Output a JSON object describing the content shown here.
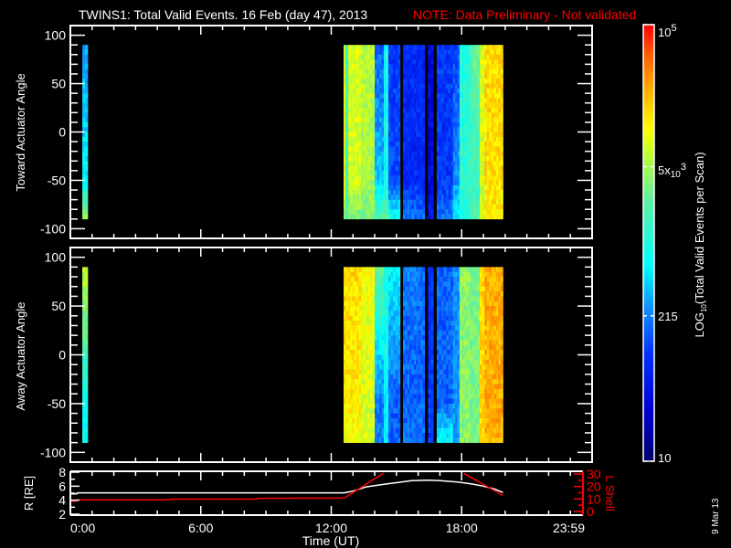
{
  "title": {
    "main": "TWINS1: Total Valid Events. 16 Feb (day  47), 2013",
    "note": "NOTE: Data Preliminary - Not validated"
  },
  "colors": {
    "ephem_R": "#ffffff",
    "ephem_L": "#ff0000",
    "axis": "#ffffff",
    "note": "#ff0000"
  },
  "date_stamp": "9 Mar 13",
  "chart_data": [
    {
      "type": "heatmap",
      "name": "toward",
      "ylabel": "Toward Actuator Angle",
      "ylim": [
        -110,
        110
      ],
      "yticks": [
        100,
        50,
        0,
        -50,
        -100
      ],
      "yticklabels": [
        "100",
        "50",
        "0",
        "-50",
        "-100"
      ],
      "xlim_hours": [
        0,
        24
      ],
      "value_units": "log10 events per scan",
      "columns_note": "each column: [t_start_h, t_end_h, value_at_+90, value_at_-50, value_at_-90]",
      "columns": [
        [
          0.55,
          0.8,
          2.5,
          2.8,
          3.6
        ],
        [
          12.57,
          12.65,
          4.0,
          4.0,
          3.6
        ],
        [
          12.65,
          12.78,
          3.2,
          3.2,
          3.4
        ],
        [
          12.78,
          13.37,
          3.9,
          3.9,
          3.5
        ],
        [
          13.37,
          14.0,
          3.8,
          3.7,
          3.5
        ],
        [
          14.0,
          14.42,
          2.2,
          2.6,
          3.4
        ],
        [
          14.42,
          14.63,
          2.9,
          2.9,
          3.4
        ],
        [
          14.63,
          15.17,
          2.0,
          2.1,
          2.9
        ],
        [
          15.3,
          16.3,
          1.9,
          1.9,
          2.3
        ],
        [
          16.45,
          16.7,
          1.6,
          1.6,
          1.8
        ],
        [
          16.85,
          17.6,
          2.0,
          2.0,
          2.3
        ],
        [
          17.6,
          17.9,
          2.1,
          2.4,
          2.8
        ],
        [
          17.9,
          18.4,
          3.0,
          3.1,
          3.0
        ],
        [
          18.4,
          18.83,
          3.4,
          3.2,
          3.3
        ],
        [
          18.83,
          19.05,
          3.9,
          3.9,
          3.8
        ],
        [
          19.05,
          19.9,
          4.2,
          4.2,
          4.1
        ]
      ]
    },
    {
      "type": "heatmap",
      "name": "away",
      "ylabel": "Away Actuator Angle",
      "ylim": [
        -110,
        110
      ],
      "yticks": [
        100,
        50,
        0,
        -50,
        -100
      ],
      "yticklabels": [
        "100",
        "50",
        "0",
        "-50",
        "-100"
      ],
      "xlim_hours": [
        0,
        24
      ],
      "value_units": "log10 events per scan",
      "columns": [
        [
          0.55,
          0.8,
          3.9,
          2.9,
          2.9
        ],
        [
          12.57,
          13.37,
          4.2,
          4.1,
          4.0
        ],
        [
          13.37,
          14.0,
          4.0,
          3.9,
          3.9
        ],
        [
          14.0,
          14.42,
          3.4,
          2.3,
          2.3
        ],
        [
          14.42,
          14.63,
          3.0,
          2.8,
          2.8
        ],
        [
          14.63,
          15.17,
          2.8,
          2.2,
          2.2
        ],
        [
          15.3,
          16.3,
          2.3,
          2.2,
          2.3
        ],
        [
          16.45,
          16.7,
          2.0,
          2.0,
          2.0
        ],
        [
          16.85,
          17.6,
          2.2,
          2.2,
          2.9
        ],
        [
          17.6,
          17.9,
          2.4,
          2.4,
          2.5
        ],
        [
          17.9,
          18.4,
          3.6,
          3.6,
          3.6
        ],
        [
          18.4,
          18.83,
          3.5,
          3.5,
          3.5
        ],
        [
          18.83,
          19.05,
          4.2,
          4.2,
          4.2
        ],
        [
          19.05,
          19.9,
          4.4,
          4.4,
          4.4
        ]
      ]
    },
    {
      "type": "line",
      "name": "ephemeris",
      "xlabel": "Time (UT)",
      "xticklabels": [
        "0:00",
        "6:00",
        "12:00",
        "18:00",
        "23:59"
      ],
      "xticks_hours": [
        0,
        6,
        12,
        18,
        24
      ],
      "ylabel_left": "R [RE]",
      "ylabel_left_main": "R [R",
      "ylabel_left_sub": "E",
      "ylabel_left_end": "]",
      "ylim_left": [
        2,
        8
      ],
      "yticklabels_left": [
        "8",
        "6",
        "4",
        "2"
      ],
      "yticks_left": [
        8,
        6,
        4,
        2
      ],
      "ylabel_right": "L Shell",
      "ylim_right": [
        0,
        30
      ],
      "yticklabels_right": [
        "30",
        "20",
        "10",
        "0"
      ],
      "yticks_right": [
        30,
        20,
        10,
        0
      ],
      "series": [
        {
          "name": "R",
          "axis": "left",
          "x": [
            0,
            0.3,
            0.31,
            12.6,
            13.0,
            13.6,
            14.5,
            15.0,
            15.7,
            16.5,
            17.0,
            17.8,
            18.5,
            19.0,
            19.5,
            19.9
          ],
          "y": [
            4.9,
            4.9,
            5.05,
            5.05,
            5.3,
            5.9,
            6.3,
            6.5,
            6.8,
            6.85,
            6.8,
            6.6,
            6.3,
            6.0,
            5.6,
            5.1
          ]
        },
        {
          "name": "L Shell",
          "axis": "right",
          "x": [
            0,
            0.25,
            0.3,
            4.6,
            4.62,
            8.6,
            8.62,
            12.6,
            14.4
          ],
          "y": [
            8.3,
            8.3,
            9.3,
            9.3,
            9.9,
            9.9,
            10.5,
            10.8,
            30.5
          ]
        },
        {
          "name": "L Shell (descending)",
          "axis": "right",
          "x": [
            18.1,
            19.9
          ],
          "y": [
            30.5,
            12.8
          ]
        }
      ]
    },
    {
      "type": "colorbar",
      "name": "colorbar",
      "range": [
        10,
        100000
      ],
      "tick_values": [
        100000,
        5000,
        215,
        10
      ],
      "label_top_base": "10",
      "label_top_exp": "5",
      "label_mid_pre": "5x",
      "label_mid_base": "10",
      "label_mid_exp": "3",
      "label_low": "215",
      "label_bottom": "10",
      "title_pre": "LOG",
      "title_sub": "10",
      "title_post": "(Total Valid  Events  per Scan)"
    }
  ]
}
